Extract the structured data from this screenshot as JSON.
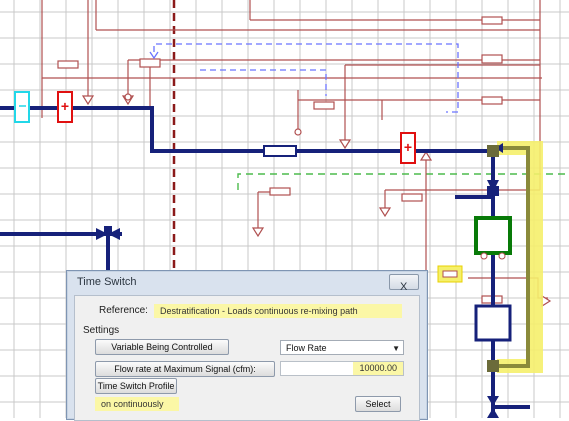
{
  "dialog": {
    "title": "Time Switch",
    "close_label": "X",
    "reference_label": "Reference:",
    "reference_value": "Destratification - Loads continuous re-mixing path",
    "settings_label": "Settings",
    "variable_button": "Variable Being Controlled",
    "variable_select_value": "Flow Rate",
    "flow_button": "Flow rate at Maximum Signal (cfm):",
    "flow_value": "10000.00",
    "profile_button": "Time Switch Profile",
    "profile_value": "on continuously",
    "select_button": "Select"
  },
  "colors": {
    "pipe": "#16217a",
    "controller_line": "#b05050",
    "dashed_blue": "#6b73ff",
    "dashed_red": "#8b1a1a",
    "dashed_green": "#4dbb4d",
    "highlight": "#f5f06b",
    "red_component": "#e01010",
    "cyan_component": "#22d7e8",
    "green_component": "#087a08"
  },
  "icons": [
    "close-icon",
    "dropdown-arrow-icon"
  ]
}
